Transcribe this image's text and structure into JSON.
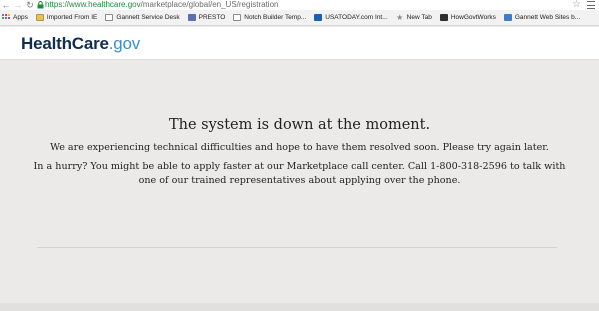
{
  "browser": {
    "url_scheme": "https://",
    "url_host": "www.healthcare.gov",
    "url_path": "/marketplace/global/en_US/registration",
    "bookmarks": [
      {
        "label": "Apps",
        "icon": "apps-icon"
      },
      {
        "label": "Imported From IE",
        "icon": "folder-icon"
      },
      {
        "label": "Gannett Service Desk",
        "icon": "page-icon"
      },
      {
        "label": "PRESTO",
        "icon": "presto-icon"
      },
      {
        "label": "Notch Builder Temp...",
        "icon": "page-icon"
      },
      {
        "label": "USATODAY.com Int...",
        "icon": "usatoday-icon"
      },
      {
        "label": "New Tab",
        "icon": "star-icon"
      },
      {
        "label": "HowGovtWorks",
        "icon": "govt-icon"
      },
      {
        "label": "Gannett Web Sites b...",
        "icon": "gannett-icon"
      }
    ]
  },
  "header": {
    "logo_primary": "HealthCare",
    "logo_suffix": ".gov"
  },
  "main": {
    "title": "The system is down at the moment.",
    "paragraph1": "We are experiencing technical difficulties and hope to have them resolved soon. Please try again later.",
    "paragraph2": "In a hurry? You might be able to apply faster at our Marketplace call center. Call 1-800-318-2596 to talk with one of our trained representatives about applying over the phone."
  },
  "colors": {
    "logo_dark": "#112e51",
    "logo_accent": "#3e8fc7",
    "page_background": "#eceae8",
    "url_secure": "#1d8a3c"
  }
}
